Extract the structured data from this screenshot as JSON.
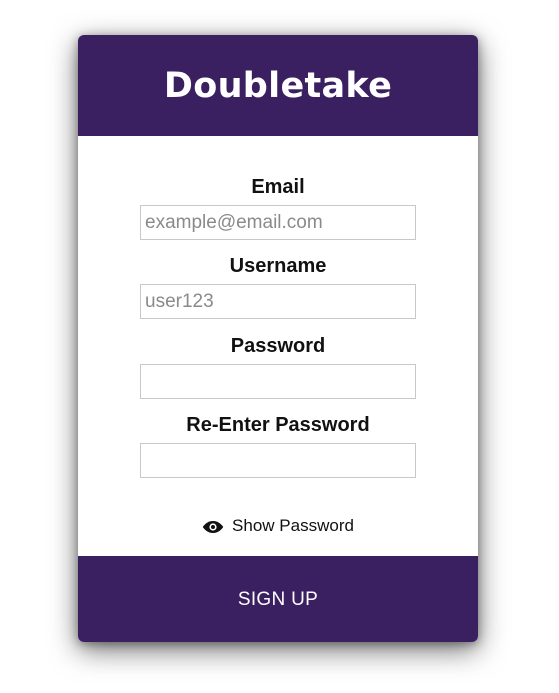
{
  "app": {
    "title": "Doubletake"
  },
  "form": {
    "email": {
      "label": "Email",
      "value": "",
      "placeholder": "example@email.com"
    },
    "username": {
      "label": "Username",
      "value": "",
      "placeholder": "user123"
    },
    "password": {
      "label": "Password",
      "value": "",
      "placeholder": ""
    },
    "reenter_password": {
      "label": "Re-Enter Password",
      "value": "",
      "placeholder": ""
    },
    "show_password": {
      "label": "Show Password",
      "icon": "eye-icon"
    }
  },
  "actions": {
    "signup_label": "SIGN UP"
  },
  "colors": {
    "brand": "#3b2061",
    "header_text": "#ffffff",
    "input_border": "#c8c8c8"
  }
}
